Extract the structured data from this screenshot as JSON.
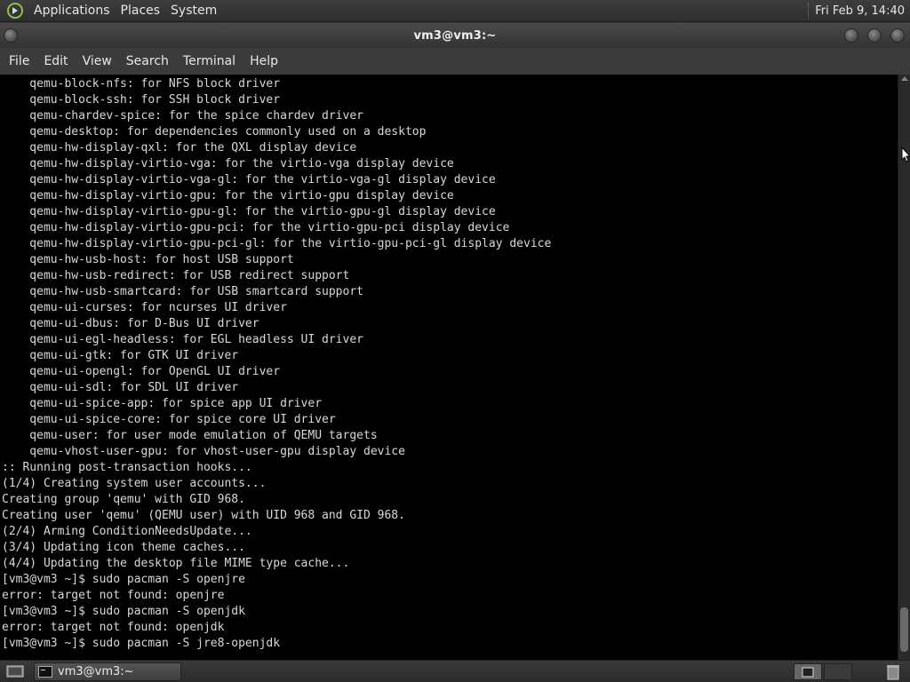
{
  "top_panel": {
    "menus": [
      "Applications",
      "Places",
      "System"
    ],
    "clock": "Fri Feb  9, 14:40"
  },
  "window": {
    "title": "vm3@vm3:~"
  },
  "menubar": [
    "File",
    "Edit",
    "View",
    "Search",
    "Terminal",
    "Help"
  ],
  "terminal": {
    "lines": [
      "    qemu-block-nfs: for NFS block driver",
      "    qemu-block-ssh: for SSH block driver",
      "    qemu-chardev-spice: for the spice chardev driver",
      "    qemu-desktop: for dependencies commonly used on a desktop",
      "    qemu-hw-display-qxl: for the QXL display device",
      "    qemu-hw-display-virtio-vga: for the virtio-vga display device",
      "    qemu-hw-display-virtio-vga-gl: for the virtio-vga-gl display device",
      "    qemu-hw-display-virtio-gpu: for the virtio-gpu display device",
      "    qemu-hw-display-virtio-gpu-gl: for the virtio-gpu-gl display device",
      "    qemu-hw-display-virtio-gpu-pci: for the virtio-gpu-pci display device",
      "    qemu-hw-display-virtio-gpu-pci-gl: for the virtio-gpu-pci-gl display device",
      "    qemu-hw-usb-host: for host USB support",
      "    qemu-hw-usb-redirect: for USB redirect support",
      "    qemu-hw-usb-smartcard: for USB smartcard support",
      "    qemu-ui-curses: for ncurses UI driver",
      "    qemu-ui-dbus: for D-Bus UI driver",
      "    qemu-ui-egl-headless: for EGL headless UI driver",
      "    qemu-ui-gtk: for GTK UI driver",
      "    qemu-ui-opengl: for OpenGL UI driver",
      "    qemu-ui-sdl: for SDL UI driver",
      "    qemu-ui-spice-app: for spice app UI driver",
      "    qemu-ui-spice-core: for spice core UI driver",
      "    qemu-user: for user mode emulation of QEMU targets",
      "    qemu-vhost-user-gpu: for vhost-user-gpu display device",
      ":: Running post-transaction hooks...",
      "(1/4) Creating system user accounts...",
      "Creating group 'qemu' with GID 968.",
      "Creating user 'qemu' (QEMU user) with UID 968 and GID 968.",
      "(2/4) Arming ConditionNeedsUpdate...",
      "(3/4) Updating icon theme caches...",
      "(4/4) Updating the desktop file MIME type cache...",
      "[vm3@vm3 ~]$ sudo pacman -S openjre",
      "error: target not found: openjre",
      "[vm3@vm3 ~]$ sudo pacman -S openjdk",
      "error: target not found: openjdk",
      "[vm3@vm3 ~]$ sudo pacman -S jre8-openjdk"
    ]
  },
  "taskbar": {
    "task_label": "vm3@vm3:~"
  },
  "icons": {
    "panel_logo": "distro-logo-icon",
    "show_desktop": "show-desktop-icon",
    "terminal_task": "terminal-icon",
    "trash": "trash-icon"
  }
}
